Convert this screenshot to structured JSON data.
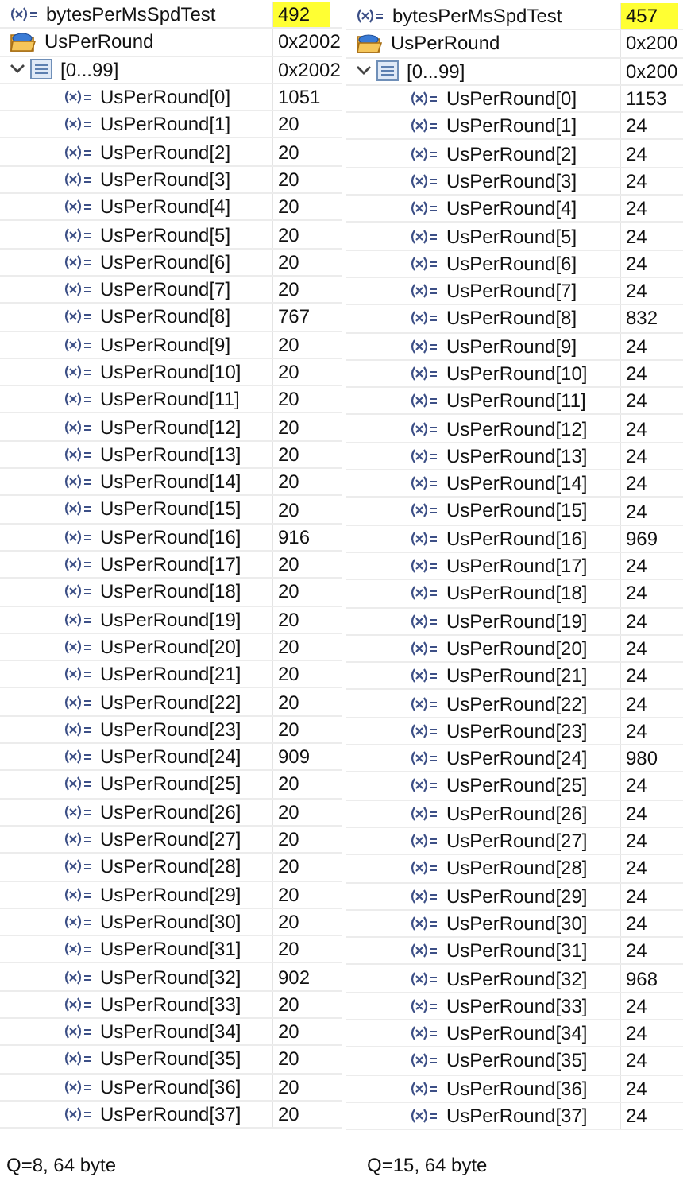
{
  "panels": [
    {
      "variables": [
        {
          "kind": "variable",
          "name": "bytesPerMsSpdTest",
          "value": "492",
          "changed": true
        },
        {
          "kind": "struct",
          "name": "UsPerRound",
          "value": "0x2002",
          "children": [
            {
              "kind": "array",
              "name": "[0...99]",
              "value": "0x2002",
              "expanded": true,
              "children": [
                {
                  "kind": "variable",
                  "name": "UsPerRound[0]",
                  "value": "1051",
                  "changed": false
                },
                {
                  "kind": "variable",
                  "name": "UsPerRound[1]",
                  "value": "20",
                  "changed": false
                },
                {
                  "kind": "variable",
                  "name": "UsPerRound[2]",
                  "value": "20",
                  "changed": false
                },
                {
                  "kind": "variable",
                  "name": "UsPerRound[3]",
                  "value": "20",
                  "changed": false
                },
                {
                  "kind": "variable",
                  "name": "UsPerRound[4]",
                  "value": "20",
                  "changed": false
                },
                {
                  "kind": "variable",
                  "name": "UsPerRound[5]",
                  "value": "20",
                  "changed": false
                },
                {
                  "kind": "variable",
                  "name": "UsPerRound[6]",
                  "value": "20",
                  "changed": false
                },
                {
                  "kind": "variable",
                  "name": "UsPerRound[7]",
                  "value": "20",
                  "changed": false
                },
                {
                  "kind": "variable",
                  "name": "UsPerRound[8]",
                  "value": "767",
                  "changed": false
                },
                {
                  "kind": "variable",
                  "name": "UsPerRound[9]",
                  "value": "20",
                  "changed": false
                },
                {
                  "kind": "variable",
                  "name": "UsPerRound[10]",
                  "value": "20",
                  "changed": false
                },
                {
                  "kind": "variable",
                  "name": "UsPerRound[11]",
                  "value": "20",
                  "changed": false
                },
                {
                  "kind": "variable",
                  "name": "UsPerRound[12]",
                  "value": "20",
                  "changed": false
                },
                {
                  "kind": "variable",
                  "name": "UsPerRound[13]",
                  "value": "20",
                  "changed": false
                },
                {
                  "kind": "variable",
                  "name": "UsPerRound[14]",
                  "value": "20",
                  "changed": false
                },
                {
                  "kind": "variable",
                  "name": "UsPerRound[15]",
                  "value": "20",
                  "changed": false
                },
                {
                  "kind": "variable",
                  "name": "UsPerRound[16]",
                  "value": "916",
                  "changed": false
                },
                {
                  "kind": "variable",
                  "name": "UsPerRound[17]",
                  "value": "20",
                  "changed": false
                },
                {
                  "kind": "variable",
                  "name": "UsPerRound[18]",
                  "value": "20",
                  "changed": false
                },
                {
                  "kind": "variable",
                  "name": "UsPerRound[19]",
                  "value": "20",
                  "changed": false
                },
                {
                  "kind": "variable",
                  "name": "UsPerRound[20]",
                  "value": "20",
                  "changed": false
                },
                {
                  "kind": "variable",
                  "name": "UsPerRound[21]",
                  "value": "20",
                  "changed": false
                },
                {
                  "kind": "variable",
                  "name": "UsPerRound[22]",
                  "value": "20",
                  "changed": false
                },
                {
                  "kind": "variable",
                  "name": "UsPerRound[23]",
                  "value": "20",
                  "changed": false
                },
                {
                  "kind": "variable",
                  "name": "UsPerRound[24]",
                  "value": "909",
                  "changed": false
                },
                {
                  "kind": "variable",
                  "name": "UsPerRound[25]",
                  "value": "20",
                  "changed": false
                },
                {
                  "kind": "variable",
                  "name": "UsPerRound[26]",
                  "value": "20",
                  "changed": false
                },
                {
                  "kind": "variable",
                  "name": "UsPerRound[27]",
                  "value": "20",
                  "changed": false
                },
                {
                  "kind": "variable",
                  "name": "UsPerRound[28]",
                  "value": "20",
                  "changed": false
                },
                {
                  "kind": "variable",
                  "name": "UsPerRound[29]",
                  "value": "20",
                  "changed": false
                },
                {
                  "kind": "variable",
                  "name": "UsPerRound[30]",
                  "value": "20",
                  "changed": false
                },
                {
                  "kind": "variable",
                  "name": "UsPerRound[31]",
                  "value": "20",
                  "changed": false
                },
                {
                  "kind": "variable",
                  "name": "UsPerRound[32]",
                  "value": "902",
                  "changed": false
                },
                {
                  "kind": "variable",
                  "name": "UsPerRound[33]",
                  "value": "20",
                  "changed": false
                },
                {
                  "kind": "variable",
                  "name": "UsPerRound[34]",
                  "value": "20",
                  "changed": false
                },
                {
                  "kind": "variable",
                  "name": "UsPerRound[35]",
                  "value": "20",
                  "changed": false
                },
                {
                  "kind": "variable",
                  "name": "UsPerRound[36]",
                  "value": "20",
                  "changed": false
                },
                {
                  "kind": "variable",
                  "name": "UsPerRound[37]",
                  "value": "20",
                  "changed": false
                }
              ]
            }
          ]
        }
      ],
      "caption": "Q=8, 64 byte"
    },
    {
      "variables": [
        {
          "kind": "variable",
          "name": "bytesPerMsSpdTest",
          "value": "457",
          "changed": true
        },
        {
          "kind": "struct",
          "name": "UsPerRound",
          "value": "0x200",
          "children": [
            {
              "kind": "array",
              "name": "[0...99]",
              "value": "0x200",
              "expanded": true,
              "children": [
                {
                  "kind": "variable",
                  "name": "UsPerRound[0]",
                  "value": "1153",
                  "changed": false
                },
                {
                  "kind": "variable",
                  "name": "UsPerRound[1]",
                  "value": "24",
                  "changed": false
                },
                {
                  "kind": "variable",
                  "name": "UsPerRound[2]",
                  "value": "24",
                  "changed": false
                },
                {
                  "kind": "variable",
                  "name": "UsPerRound[3]",
                  "value": "24",
                  "changed": false
                },
                {
                  "kind": "variable",
                  "name": "UsPerRound[4]",
                  "value": "24",
                  "changed": false
                },
                {
                  "kind": "variable",
                  "name": "UsPerRound[5]",
                  "value": "24",
                  "changed": false
                },
                {
                  "kind": "variable",
                  "name": "UsPerRound[6]",
                  "value": "24",
                  "changed": false
                },
                {
                  "kind": "variable",
                  "name": "UsPerRound[7]",
                  "value": "24",
                  "changed": false
                },
                {
                  "kind": "variable",
                  "name": "UsPerRound[8]",
                  "value": "832",
                  "changed": false
                },
                {
                  "kind": "variable",
                  "name": "UsPerRound[9]",
                  "value": "24",
                  "changed": false
                },
                {
                  "kind": "variable",
                  "name": "UsPerRound[10]",
                  "value": "24",
                  "changed": false
                },
                {
                  "kind": "variable",
                  "name": "UsPerRound[11]",
                  "value": "24",
                  "changed": false
                },
                {
                  "kind": "variable",
                  "name": "UsPerRound[12]",
                  "value": "24",
                  "changed": false
                },
                {
                  "kind": "variable",
                  "name": "UsPerRound[13]",
                  "value": "24",
                  "changed": false
                },
                {
                  "kind": "variable",
                  "name": "UsPerRound[14]",
                  "value": "24",
                  "changed": false
                },
                {
                  "kind": "variable",
                  "name": "UsPerRound[15]",
                  "value": "24",
                  "changed": false
                },
                {
                  "kind": "variable",
                  "name": "UsPerRound[16]",
                  "value": "969",
                  "changed": false
                },
                {
                  "kind": "variable",
                  "name": "UsPerRound[17]",
                  "value": "24",
                  "changed": false
                },
                {
                  "kind": "variable",
                  "name": "UsPerRound[18]",
                  "value": "24",
                  "changed": false
                },
                {
                  "kind": "variable",
                  "name": "UsPerRound[19]",
                  "value": "24",
                  "changed": false
                },
                {
                  "kind": "variable",
                  "name": "UsPerRound[20]",
                  "value": "24",
                  "changed": false
                },
                {
                  "kind": "variable",
                  "name": "UsPerRound[21]",
                  "value": "24",
                  "changed": false
                },
                {
                  "kind": "variable",
                  "name": "UsPerRound[22]",
                  "value": "24",
                  "changed": false
                },
                {
                  "kind": "variable",
                  "name": "UsPerRound[23]",
                  "value": "24",
                  "changed": false
                },
                {
                  "kind": "variable",
                  "name": "UsPerRound[24]",
                  "value": "980",
                  "changed": false
                },
                {
                  "kind": "variable",
                  "name": "UsPerRound[25]",
                  "value": "24",
                  "changed": false
                },
                {
                  "kind": "variable",
                  "name": "UsPerRound[26]",
                  "value": "24",
                  "changed": false
                },
                {
                  "kind": "variable",
                  "name": "UsPerRound[27]",
                  "value": "24",
                  "changed": false
                },
                {
                  "kind": "variable",
                  "name": "UsPerRound[28]",
                  "value": "24",
                  "changed": false
                },
                {
                  "kind": "variable",
                  "name": "UsPerRound[29]",
                  "value": "24",
                  "changed": false
                },
                {
                  "kind": "variable",
                  "name": "UsPerRound[30]",
                  "value": "24",
                  "changed": false
                },
                {
                  "kind": "variable",
                  "name": "UsPerRound[31]",
                  "value": "24",
                  "changed": false
                },
                {
                  "kind": "variable",
                  "name": "UsPerRound[32]",
                  "value": "968",
                  "changed": false
                },
                {
                  "kind": "variable",
                  "name": "UsPerRound[33]",
                  "value": "24",
                  "changed": false
                },
                {
                  "kind": "variable",
                  "name": "UsPerRound[34]",
                  "value": "24",
                  "changed": false
                },
                {
                  "kind": "variable",
                  "name": "UsPerRound[35]",
                  "value": "24",
                  "changed": false
                },
                {
                  "kind": "variable",
                  "name": "UsPerRound[36]",
                  "value": "24",
                  "changed": false
                },
                {
                  "kind": "variable",
                  "name": "UsPerRound[37]",
                  "value": "24",
                  "changed": false
                }
              ]
            }
          ]
        }
      ],
      "caption": "Q=15, 64 byte"
    }
  ]
}
